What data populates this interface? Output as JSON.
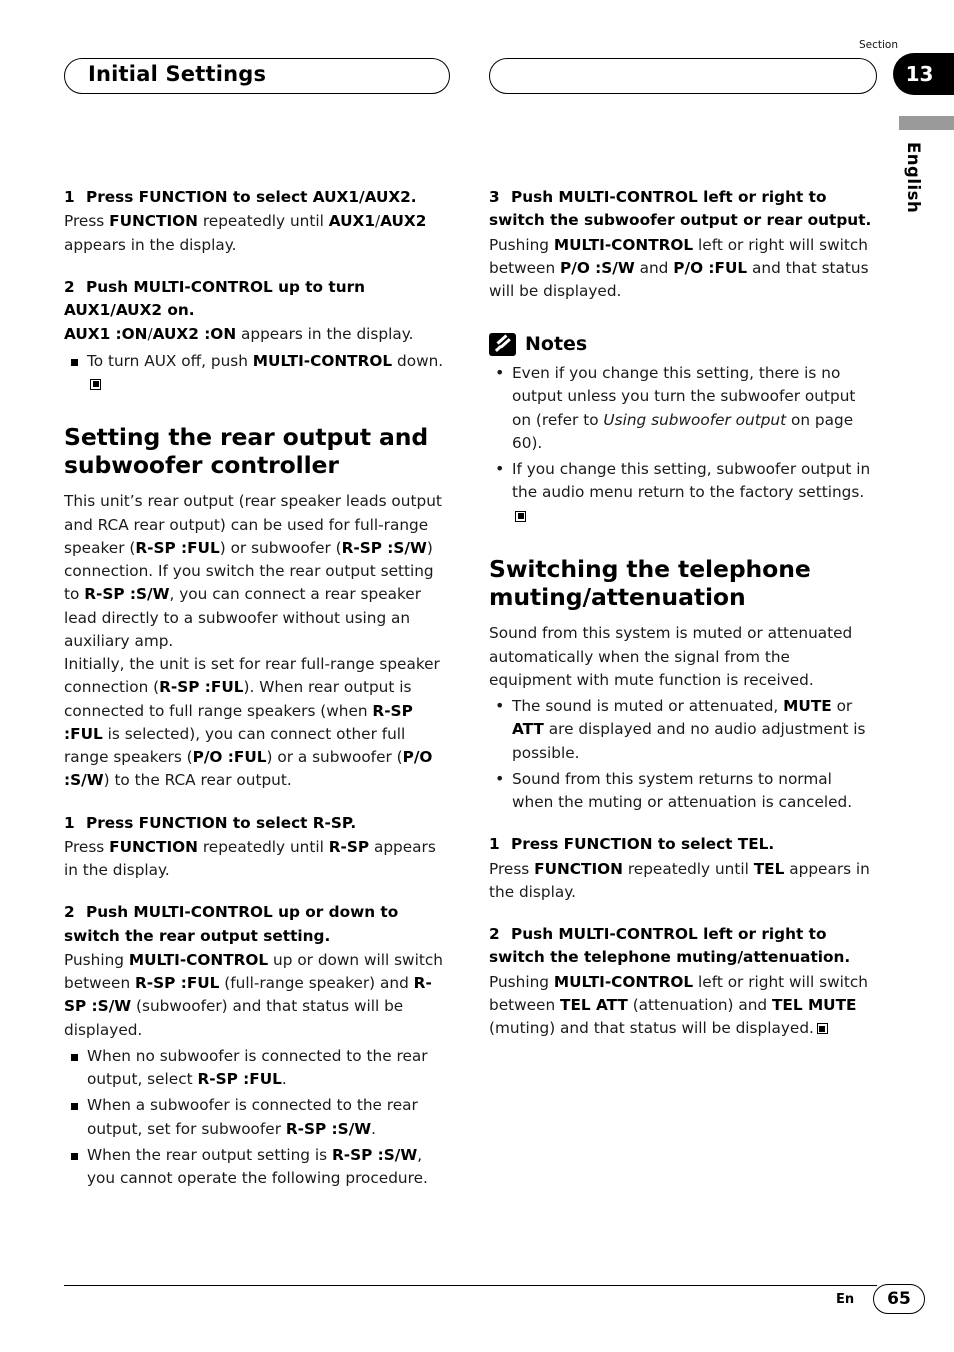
{
  "header": {
    "title": "Initial Settings",
    "section_label": "Section",
    "section_number": "13",
    "language": "English"
  },
  "footer": {
    "lang_code": "En",
    "page_number": "65"
  },
  "left_column": {
    "step1": {
      "num": "1",
      "title": "Press FUNCTION to select AUX1/AUX2.",
      "body_1": "Press ",
      "body_b1": "FUNCTION",
      "body_2": " repeatedly until ",
      "body_b2": "AUX1",
      "body_3": "/",
      "body_b3": "AUX2",
      "body_4": " appears in the display."
    },
    "step2": {
      "num": "2",
      "title": "Push MULTI-CONTROL up to turn AUX1/AUX2 on.",
      "body_b1": "AUX1 :ON",
      "body_1": "/",
      "body_b2": "AUX2 :ON",
      "body_2": " appears in the display.",
      "bullet_1": "To turn AUX off, push ",
      "bullet_b1": "MULTI-CONTROL",
      "bullet_2": " down."
    },
    "heading": "Setting the rear output and subwoofer controller",
    "intro": {
      "t1": "This unit’s rear output (rear speaker leads output and RCA rear output) can be used for full-range speaker (",
      "b1": "R-SP :FUL",
      "t2": ") or subwoofer (",
      "b2": "R-SP :S/W",
      "t3": ") connection. If you switch the rear output setting to ",
      "b3": "R-SP :S/W",
      "t4": ", you can connect a rear speaker lead directly to a subwoofer without using an auxiliary amp.",
      "t5": "Initially, the unit is set for rear full-range speaker connection (",
      "b4": "R-SP :FUL",
      "t6": "). When rear output is connected to full range speakers (when ",
      "b5": "R-SP :FUL",
      "t7": " is selected), you can connect other full range speakers (",
      "b6": "P/O :FUL",
      "t8": ") or a subwoofer (",
      "b7": "P/O :S/W",
      "t9": ") to the RCA rear output."
    },
    "step3": {
      "num": "1",
      "title": "Press FUNCTION to select R-SP.",
      "body_1": "Press ",
      "body_b1": "FUNCTION",
      "body_2": " repeatedly until ",
      "body_b2": "R-SP",
      "body_3": " appears in the display."
    },
    "step4": {
      "num": "2",
      "title": "Push MULTI-CONTROL up or down to switch the rear output setting.",
      "body_1": "Pushing ",
      "body_b1": "MULTI-CONTROL",
      "body_2": " up or down will switch between ",
      "body_b2": "R-SP :FUL",
      "body_3": " (full-range speaker) and ",
      "body_b3": "R-SP :S/W",
      "body_4": " (subwoofer) and that status will be displayed.",
      "bullet1_1": "When no subwoofer is connected to the rear output, select ",
      "bullet1_b": "R-SP :FUL",
      "bullet1_2": ".",
      "bullet2_1": "When a subwoofer is connected to the rear output, set for subwoofer ",
      "bullet2_b": "R-SP :S/W",
      "bullet2_2": ".",
      "bullet3_1": "When the rear output setting is ",
      "bullet3_b": "R-SP :S/W",
      "bullet3_2": ", you cannot operate the following procedure."
    }
  },
  "right_column": {
    "step3": {
      "num": "3",
      "title": "Push MULTI-CONTROL left or right to switch the subwoofer output or rear output.",
      "body_1": "Pushing ",
      "body_b1": "MULTI-CONTROL",
      "body_2": " left or right will switch between ",
      "body_b2": "P/O :S/W",
      "body_3": " and ",
      "body_b3": "P/O :FUL",
      "body_4": " and that status will be displayed."
    },
    "notes": {
      "title": "Notes",
      "note1_1": "Even if you change this setting, there is no output unless you turn the subwoofer output on (refer to ",
      "note1_i": "Using subwoofer output",
      "note1_2": " on page 60).",
      "note2": "If you change this setting, subwoofer output in the audio menu return to the factory settings."
    },
    "heading": "Switching the telephone muting/attenuation",
    "intro": "Sound from this system is muted or attenuated automatically when the signal from the equipment with mute function is received.",
    "bullet1_1": "The sound is muted or attenuated, ",
    "bullet1_b1": "MUTE",
    "bullet1_2": " or ",
    "bullet1_b2": "ATT",
    "bullet1_3": " are displayed and no audio adjustment is possible.",
    "bullet2": "Sound from this system returns to normal when the muting or attenuation is canceled.",
    "step1": {
      "num": "1",
      "title": "Press FUNCTION to select TEL.",
      "body_1": "Press ",
      "body_b1": "FUNCTION",
      "body_2": " repeatedly until ",
      "body_b2": "TEL",
      "body_3": " appears in the display."
    },
    "step2": {
      "num": "2",
      "title": "Push MULTI-CONTROL left or right to switch the telephone muting/attenuation.",
      "body_1": "Pushing ",
      "body_b1": "MULTI-CONTROL",
      "body_2": " left or right will switch between ",
      "body_b2": "TEL ATT",
      "body_3": " (attenuation) and ",
      "body_b3": "TEL MUTE",
      "body_4": " (muting) and that status will be displayed."
    }
  }
}
